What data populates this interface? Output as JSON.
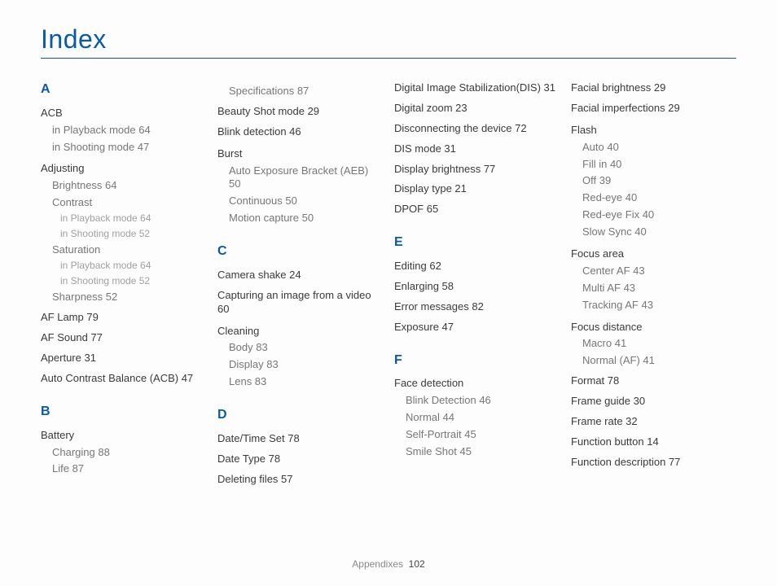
{
  "title": "Index",
  "footer": {
    "section": "Appendixes",
    "page": "102"
  },
  "col1": {
    "A": {
      "letter": "A",
      "acb": "ACB",
      "acb_play": "in Playback mode  64",
      "acb_shoot": "in Shooting mode  47",
      "adjusting": "Adjusting",
      "brightness": "Brightness  64",
      "contrast": "Contrast",
      "contrast_play": "in Playback mode  64",
      "contrast_shoot": "in Shooting mode  52",
      "saturation": "Saturation",
      "sat_play": "in Playback mode  64",
      "sat_shoot": "in Shooting mode  52",
      "sharpness": "Sharpness  52",
      "aflamp": "AF Lamp  79",
      "afsound": "AF Sound  77",
      "aperture": "Aperture  31",
      "acb2": "Auto Contrast Balance (ACB)  47"
    },
    "B": {
      "letter": "B",
      "battery": "Battery",
      "charging": "Charging  88",
      "life": "Life  87"
    }
  },
  "col2": {
    "spec": "Specifications  87",
    "beauty": "Beauty Shot mode  29",
    "blink": "Blink detection  46",
    "burst": "Burst",
    "aeb": "Auto Exposure Bracket (AEB)  50",
    "cont": "Continuous  50",
    "motion": "Motion capture  50",
    "C": {
      "letter": "C",
      "shake": "Camera shake  24",
      "capimg": "Capturing an image from a video  60",
      "cleaning": "Cleaning",
      "body": "Body  83",
      "display": "Display  83",
      "lens": "Lens  83"
    },
    "D": {
      "letter": "D",
      "datetime": "Date/Time Set  78",
      "datetype": "Date Type  78",
      "delete": "Deleting files  57"
    }
  },
  "col3": {
    "dis": "Digital Image Stabilization(DIS)  31",
    "dzoom": "Digital zoom  23",
    "disc": "Disconnecting the device  72",
    "dismode": "DIS mode  31",
    "dbright": "Display brightness  77",
    "dtype": "Display type  21",
    "dpof": "DPOF  65",
    "E": {
      "letter": "E",
      "editing": "Editing  62",
      "enlarge": "Enlarging  58",
      "errors": "Error messages  82",
      "exposure": "Exposure  47"
    },
    "F": {
      "letter": "F",
      "facedet": "Face detection",
      "blink": "Blink Detection  46",
      "normal": "Normal  44",
      "self": "Self-Portrait  45",
      "smile": "Smile Shot  45"
    }
  },
  "col4": {
    "fbright": "Facial brightness  29",
    "fimp": "Facial imperfections  29",
    "flash": "Flash",
    "auto": "Auto  40",
    "fillin": "Fill in  40",
    "off": "Off  39",
    "redeye": "Red-eye  40",
    "redeyefix": "Red-eye Fix  40",
    "slowsync": "Slow Sync  40",
    "focusarea": "Focus area",
    "center": "Center AF  43",
    "multi": "Multi AF  43",
    "tracking": "Tracking AF  43",
    "focusdist": "Focus distance",
    "macro": "Macro  41",
    "normalaf": "Normal (AF)  41",
    "format": "Format  78",
    "frameguide": "Frame guide  30",
    "framerate": "Frame rate  32",
    "funcbtn": "Function button  14",
    "funcdesc": "Function description  77"
  }
}
